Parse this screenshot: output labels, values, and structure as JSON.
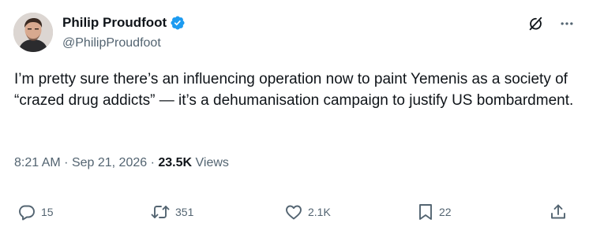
{
  "user": {
    "display_name": "Philip Proudfoot",
    "handle": "@PhilipProudfoot",
    "verified_icon": "verified-badge-icon",
    "verified_color": "#1d9bf0"
  },
  "top_actions": {
    "grok_icon": "grok-icon",
    "more_icon": "more-icon"
  },
  "tweet": {
    "text": "I’m pretty sure there’s an influencing operation now to paint Yemenis as a society of “crazed drug addicts” — it’s a dehumanisation campaign to justify US bombardment."
  },
  "meta": {
    "time": "8:21 AM",
    "separator": "·",
    "date": "Sep 21, 2026",
    "separator2": "·",
    "views_count": "23.5K",
    "views_label": "Views"
  },
  "actions": {
    "reply_count": "15",
    "repost_count": "351",
    "like_count": "2.1K",
    "bookmark_count": "22"
  },
  "colors": {
    "text_primary": "#0f1419",
    "text_secondary": "#536471",
    "accent": "#1d9bf0"
  }
}
